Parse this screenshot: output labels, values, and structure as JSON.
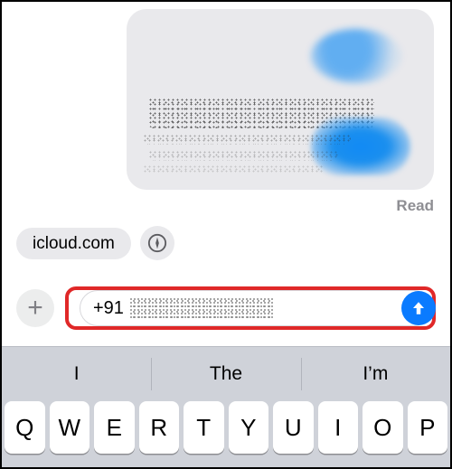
{
  "conversation": {
    "read_receipt": "Read"
  },
  "link_preview": {
    "domain": "icloud.com"
  },
  "compose": {
    "value_prefix": "+91",
    "add_icon_glyph": "+"
  },
  "predictive": [
    "I",
    "The",
    "I’m"
  ],
  "keyboard_row1": [
    "Q",
    "W",
    "E",
    "R",
    "T",
    "Y",
    "U",
    "I",
    "O",
    "P"
  ]
}
